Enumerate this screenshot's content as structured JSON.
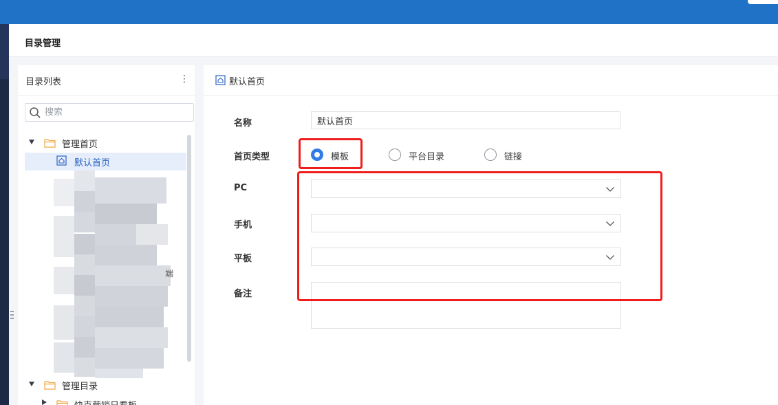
{
  "page": {
    "title": "目录管理"
  },
  "directory_list": {
    "title": "目录列表",
    "more_icon": "kebab-icon",
    "search": {
      "placeholder": "搜索",
      "value": ""
    },
    "tree": [
      {
        "label": "管理首页",
        "expanded": true,
        "icon": "folder-icon"
      },
      {
        "label": "默认首页",
        "selected": true,
        "icon": "home-icon"
      },
      {
        "label": "管理目录",
        "expanded": true,
        "icon": "folder-icon"
      },
      {
        "label": "快克营销日看板",
        "expanded": false,
        "icon": "folder-icon"
      }
    ],
    "partial_right_char": "端"
  },
  "detail": {
    "header_title": "默认首页",
    "fields": {
      "name": {
        "label": "名称",
        "value": "默认首页"
      },
      "home_type": {
        "label": "首页类型",
        "options": [
          {
            "label": "模板",
            "checked": true
          },
          {
            "label": "平台目录",
            "checked": false
          },
          {
            "label": "链接",
            "checked": false
          }
        ]
      },
      "pc": {
        "label": "PC",
        "value": ""
      },
      "mobile": {
        "label": "手机",
        "value": ""
      },
      "tablet": {
        "label": "平板",
        "value": ""
      },
      "remark": {
        "label": "备注",
        "value": ""
      }
    }
  },
  "colors": {
    "topbar": "#1f72c6",
    "accent": "#2f7ce6",
    "highlight": "#f01d1d",
    "selected_row": "#e6eefb"
  }
}
